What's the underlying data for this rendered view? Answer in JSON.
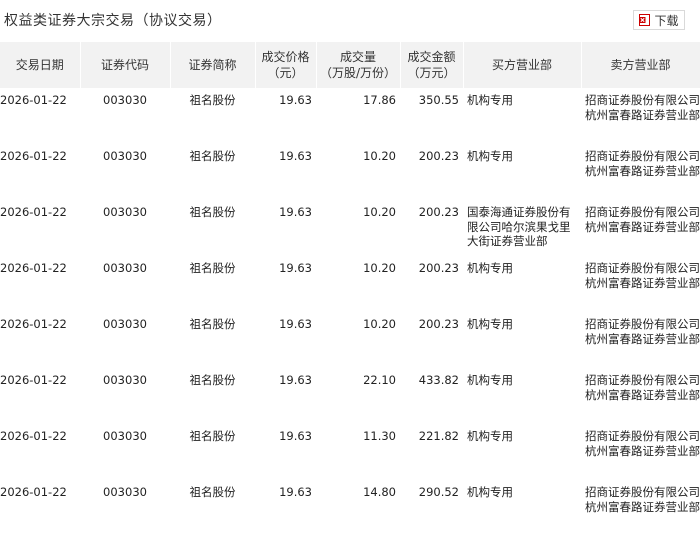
{
  "header": {
    "title": "权益类证券大宗交易（协议交易）",
    "download_label": "下载",
    "download_icon": "excel-file-icon",
    "accent": "#cc0000"
  },
  "table": {
    "columns": [
      {
        "label": "交易日期",
        "sub": ""
      },
      {
        "label": "证券代码",
        "sub": ""
      },
      {
        "label": "证券简称",
        "sub": ""
      },
      {
        "label": "成交价格",
        "sub": "（元）"
      },
      {
        "label": "成交量",
        "sub": "（万股/万份）"
      },
      {
        "label": "成交金额",
        "sub": "（万元）"
      },
      {
        "label": "买方营业部",
        "sub": ""
      },
      {
        "label": "卖方营业部",
        "sub": ""
      }
    ],
    "rows": [
      {
        "date": "2026-01-22",
        "code": "003030",
        "name": "祖名股份",
        "price": "19.63",
        "volume": "17.86",
        "amount": "350.55",
        "buyer": "机构专用",
        "seller": "招商证券股份有限公司杭州富春路证券营业部"
      },
      {
        "date": "2026-01-22",
        "code": "003030",
        "name": "祖名股份",
        "price": "19.63",
        "volume": "10.20",
        "amount": "200.23",
        "buyer": "机构专用",
        "seller": "招商证券股份有限公司杭州富春路证券营业部"
      },
      {
        "date": "2026-01-22",
        "code": "003030",
        "name": "祖名股份",
        "price": "19.63",
        "volume": "10.20",
        "amount": "200.23",
        "buyer": "国泰海通证券股份有限公司哈尔滨果戈里大街证券营业部",
        "seller": "招商证券股份有限公司杭州富春路证券营业部"
      },
      {
        "date": "2026-01-22",
        "code": "003030",
        "name": "祖名股份",
        "price": "19.63",
        "volume": "10.20",
        "amount": "200.23",
        "buyer": "机构专用",
        "seller": "招商证券股份有限公司杭州富春路证券营业部"
      },
      {
        "date": "2026-01-22",
        "code": "003030",
        "name": "祖名股份",
        "price": "19.63",
        "volume": "10.20",
        "amount": "200.23",
        "buyer": "机构专用",
        "seller": "招商证券股份有限公司杭州富春路证券营业部"
      },
      {
        "date": "2026-01-22",
        "code": "003030",
        "name": "祖名股份",
        "price": "19.63",
        "volume": "22.10",
        "amount": "433.82",
        "buyer": "机构专用",
        "seller": "招商证券股份有限公司杭州富春路证券营业部"
      },
      {
        "date": "2026-01-22",
        "code": "003030",
        "name": "祖名股份",
        "price": "19.63",
        "volume": "11.30",
        "amount": "221.82",
        "buyer": "机构专用",
        "seller": "招商证券股份有限公司杭州富春路证券营业部"
      },
      {
        "date": "2026-01-22",
        "code": "003030",
        "name": "祖名股份",
        "price": "19.63",
        "volume": "14.80",
        "amount": "290.52",
        "buyer": "机构专用",
        "seller": "招商证券股份有限公司杭州富春路证券营业部"
      }
    ]
  }
}
